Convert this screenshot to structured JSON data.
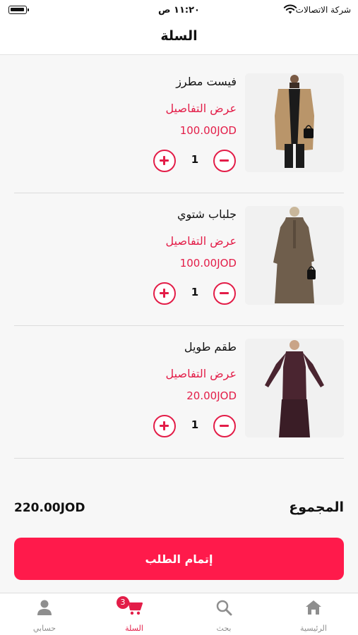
{
  "status_bar": {
    "time": "١١:٢٠ ص",
    "carrier": "شركة الاتصالات",
    "battery_icon": "battery-icon",
    "wifi_icon": "wifi-icon"
  },
  "header": {
    "title": "السلة"
  },
  "cart": {
    "items": [
      {
        "name": "فيست مطرز",
        "details_label": "عرض التفاصيل",
        "price": "100.00JOD",
        "quantity": "1",
        "image": "embroidered-vest-photo"
      },
      {
        "name": "جلباب شتوي",
        "details_label": "عرض التفاصيل",
        "price": "100.00JOD",
        "quantity": "1",
        "image": "winter-jilbab-photo"
      },
      {
        "name": "طقم طويل",
        "details_label": "عرض التفاصيل",
        "price": "20.00JOD",
        "quantity": "1",
        "image": "long-set-photo"
      }
    ]
  },
  "summary": {
    "total_label": "المجموع",
    "total_value": "220.00JOD"
  },
  "checkout": {
    "label": "إتمام الطلب"
  },
  "tab_bar": {
    "tabs": [
      {
        "label": "الرئيسية",
        "icon": "home-icon"
      },
      {
        "label": "بحث",
        "icon": "search-icon"
      },
      {
        "label": "السلة",
        "icon": "cart-icon",
        "badge": "3",
        "active": true
      },
      {
        "label": "حسابي",
        "icon": "person-icon"
      }
    ]
  },
  "colors": {
    "accent": "#e31d48",
    "button": "#ff1a4b",
    "inactive_tab": "#8e8e8e"
  }
}
